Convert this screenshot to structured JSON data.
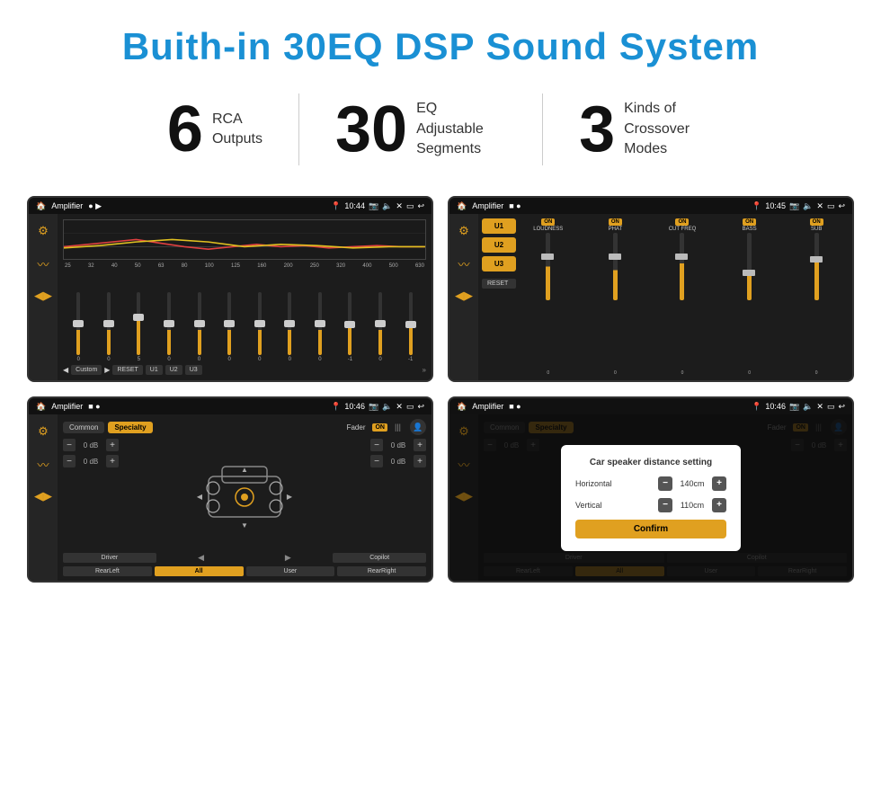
{
  "header": {
    "title": "Buith-in 30EQ DSP Sound System"
  },
  "stats": [
    {
      "number": "6",
      "label": "RCA\nOutputs"
    },
    {
      "number": "30",
      "label": "EQ Adjustable\nSegments"
    },
    {
      "number": "3",
      "label": "Kinds of\nCrossover Modes"
    }
  ],
  "screens": {
    "eq": {
      "title": "Amplifier",
      "time": "10:44",
      "freq_labels": [
        "25",
        "32",
        "40",
        "50",
        "63",
        "80",
        "100",
        "125",
        "160",
        "200",
        "250",
        "320",
        "400",
        "500",
        "630"
      ],
      "slider_vals": [
        "0",
        "0",
        "0",
        "5",
        "0",
        "0",
        "0",
        "0",
        "0",
        "-1",
        "0",
        "-1"
      ],
      "buttons": [
        "Custom",
        "RESET",
        "U1",
        "U2",
        "U3"
      ]
    },
    "crossover": {
      "title": "Amplifier",
      "time": "10:45",
      "u_buttons": [
        "U1",
        "U2",
        "U3"
      ],
      "channels": [
        "LOUDNESS",
        "PHAT",
        "CUT FREQ",
        "BASS",
        "SUB"
      ],
      "reset_label": "RESET"
    },
    "fader": {
      "title": "Amplifier",
      "time": "10:46",
      "tabs": [
        "Common",
        "Specialty"
      ],
      "fader_label": "Fader",
      "fader_on": "ON",
      "vol_rows": [
        "0 dB",
        "0 dB",
        "0 dB",
        "0 dB"
      ],
      "bottom_btns": [
        "Driver",
        "",
        "",
        "Copilot",
        "RearLeft",
        "All",
        "User",
        "RearRight"
      ]
    },
    "dialog": {
      "title": "Amplifier",
      "time": "10:46",
      "tabs": [
        "Common",
        "Specialty"
      ],
      "dialog_title": "Car speaker distance setting",
      "horizontal_label": "Horizontal",
      "horizontal_val": "140cm",
      "vertical_label": "Vertical",
      "vertical_val": "110cm",
      "confirm_label": "Confirm",
      "bottom_btns": [
        "Driver",
        "Copilot",
        "RearLeft",
        "User",
        "RearRight"
      ]
    }
  }
}
